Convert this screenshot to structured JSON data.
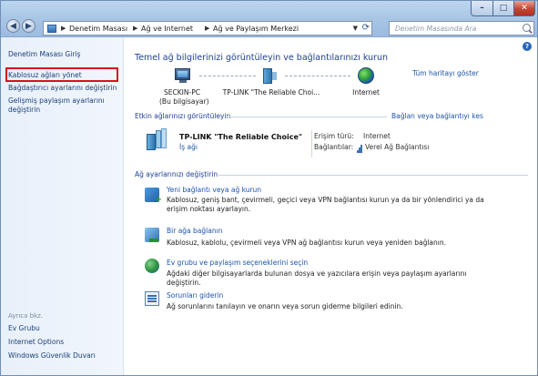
{
  "window": {
    "min": "–",
    "max": "□",
    "close": "✕"
  },
  "address": {
    "crumbs": [
      "Denetim Masası",
      "Ağ ve Internet",
      "Ağ ve Paylaşım Merkezi"
    ],
    "search_placeholder": "Denetim Masasında Ara"
  },
  "sidebar": {
    "home": "Denetim Masası Giriş",
    "items": [
      "Kablosuz ağları yönet",
      "Bağdaştırıcı ayarlarını değiştirin",
      "Gelişmiş paylaşım ayarlarını değiştirin"
    ],
    "see_also_title": "Ayrıca bkz.",
    "see_also": [
      "Ev Grubu",
      "Internet Options",
      "Windows Güvenlik Duvarı"
    ]
  },
  "main": {
    "title": "Temel ağ bilgilerinizi görüntüleyin ve bağlantılarınızı kurun",
    "full_map": "Tüm haritayı göster",
    "nodes": {
      "pc_name": "SECKIN-PC",
      "pc_sub": "(Bu bilgisayar)",
      "router": "TP-LINK \"The Reliable Choi...",
      "internet": "Internet"
    },
    "active_title": "Etkin ağlarınızı görüntüleyin",
    "connect_link": "Bağlan veya bağlantıyı kes",
    "network": {
      "name": "TP-LINK \"The Reliable Choice\"",
      "type": "İş ağı",
      "access_label": "Erişim türü:",
      "access_value": "Internet",
      "conn_label": "Bağlantılar:",
      "conn_value": "Verel Ağ Bağlantısı"
    },
    "settings_title": "Ağ ayarlarınızı değiştirin",
    "tasks": [
      {
        "link": "Yeni bağlantı veya ağ kurun",
        "desc": "Kablosuz, geniş bant, çevirmeli, geçici veya VPN bağlantısı kurun ya da bir yönlendirici ya da erişim noktası ayarlayın."
      },
      {
        "link": "Bir ağa bağlanın",
        "desc": "Kablosuz, kablolu, çevirmeli veya VPN ağ bağlantısı kurun veya yeniden bağlanın."
      },
      {
        "link": "Ev grubu ve paylaşım seçeneklerini seçin",
        "desc": "Ağdaki diğer bilgisayarlarda bulunan dosya ve yazıcılara erişin veya paylaşım ayarlarını değiştirin."
      },
      {
        "link": "Sorunları giderin",
        "desc": "Ağ sorunlarını tanılayın ve onarın veya sorun giderme bilgileri edinin."
      }
    ]
  }
}
